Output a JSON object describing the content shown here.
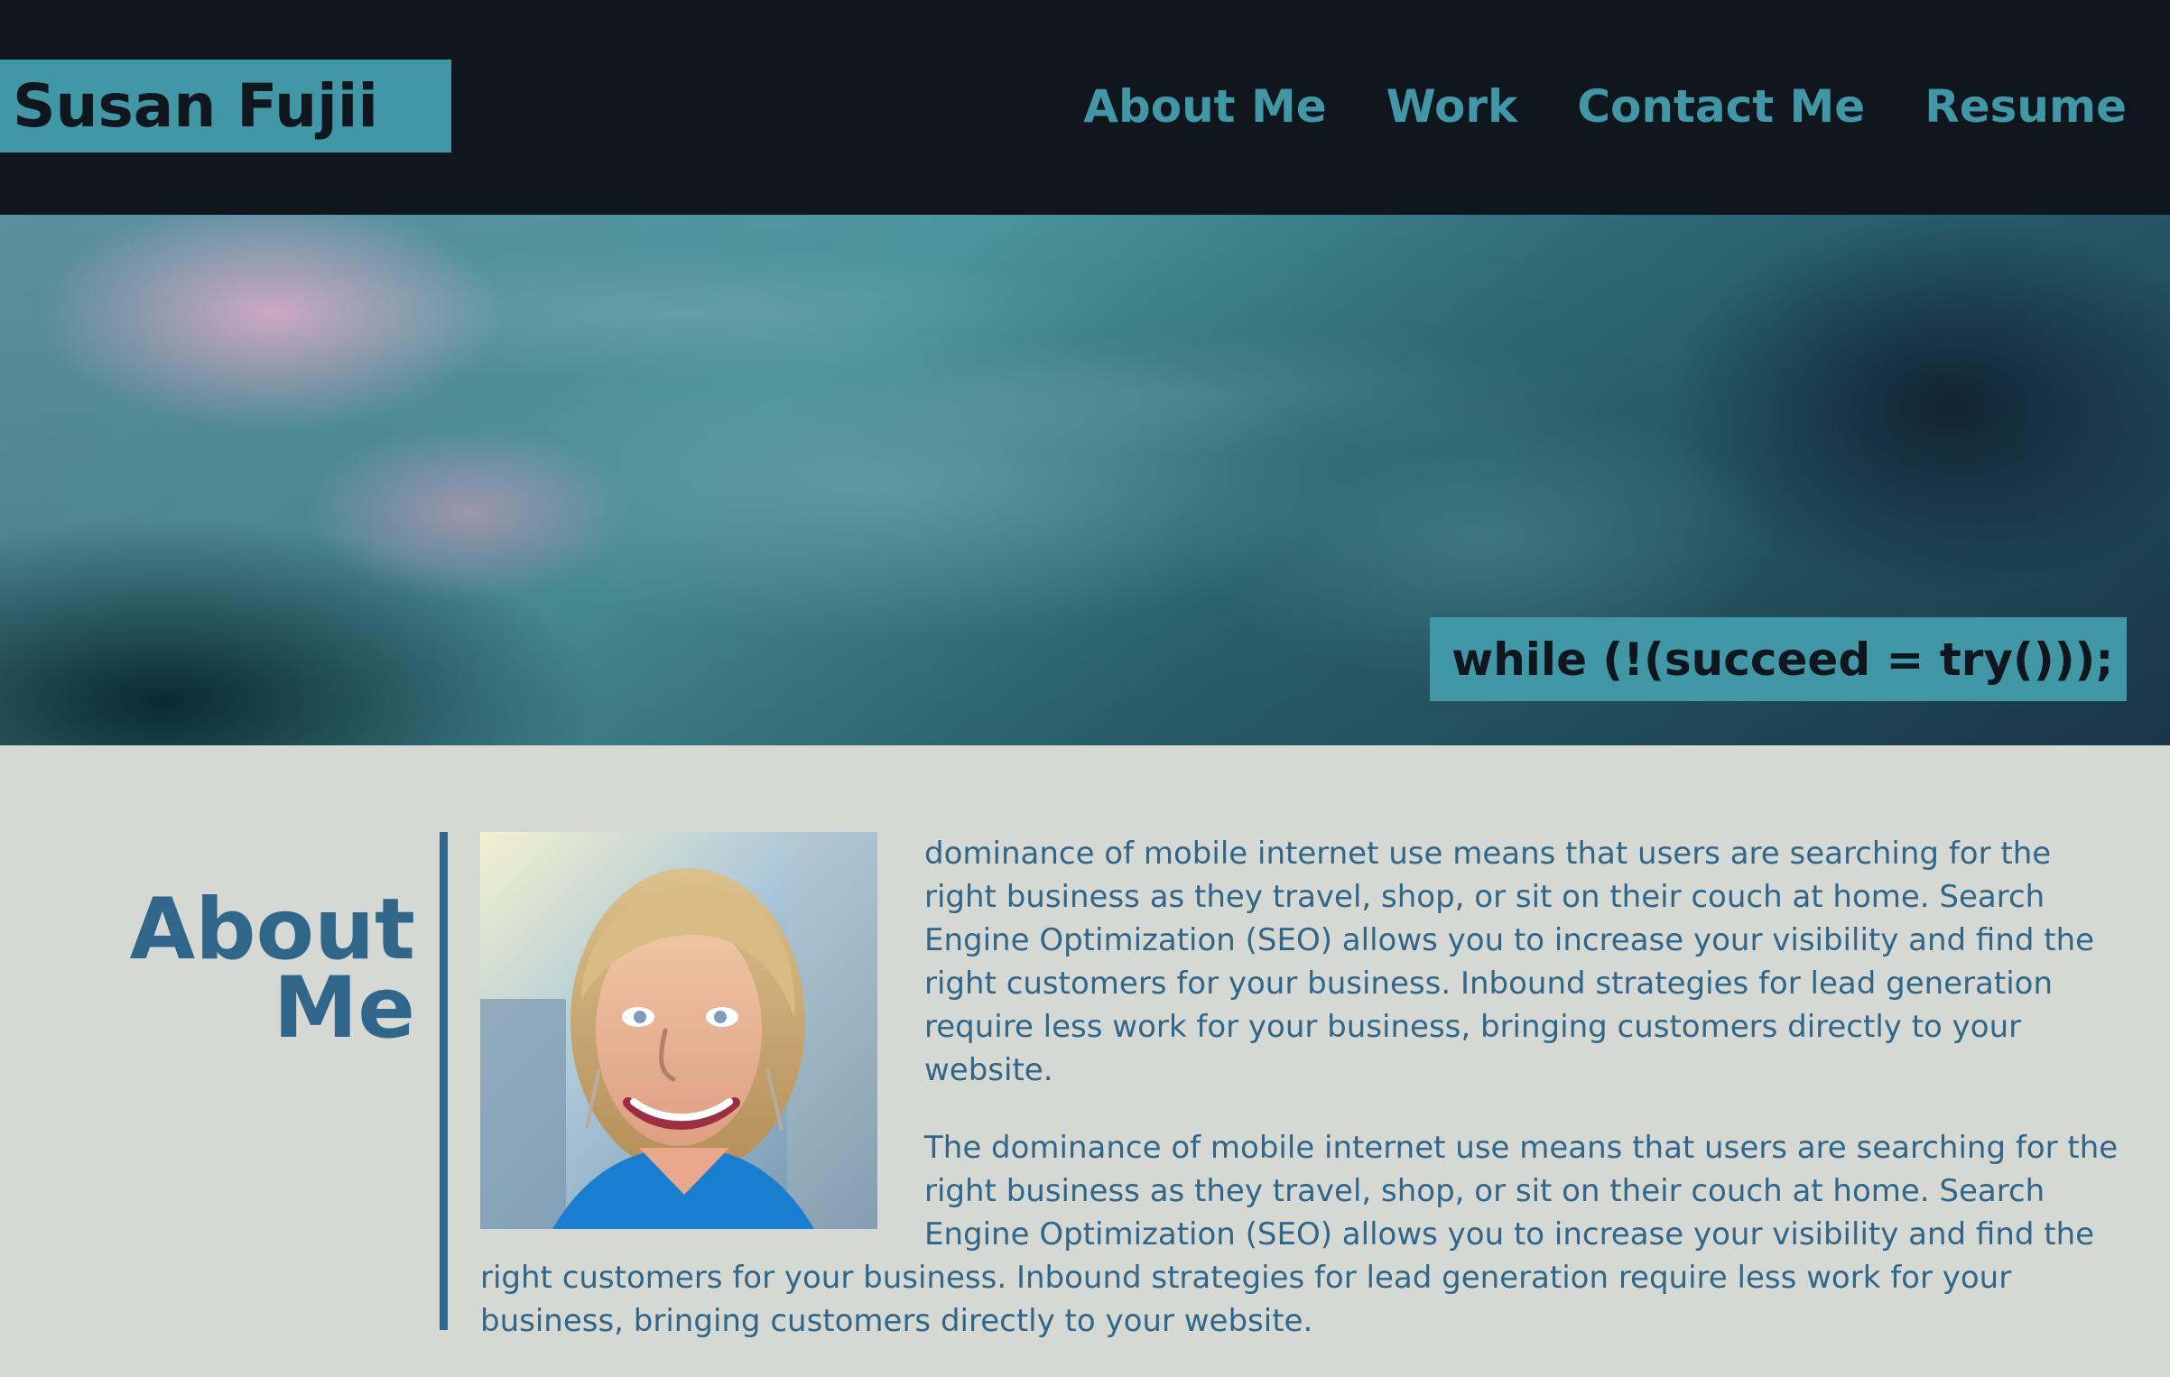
{
  "header": {
    "brand": "Susan Fujii",
    "nav": [
      {
        "label": "About Me"
      },
      {
        "label": "Work"
      },
      {
        "label": "Contact Me"
      },
      {
        "label": "Resume"
      }
    ]
  },
  "hero": {
    "code_line": "while (!(succeed = try()));"
  },
  "about": {
    "title": "About\nMe",
    "paragraphs": [
      "dominance of mobile internet use means that users are searching for the right business as they travel, shop, or sit on their couch at home. Search Engine Optimization (SEO) allows you to increase your visibility and find the right customers for your business. Inbound strategies for lead generation require less work for your business, bringing customers directly to your website.",
      "The dominance of mobile internet use means that users are searching for the right business as they travel, shop, or sit on their couch at home. Search Engine Optimization (SEO) allows you to increase your visibility and find the right customers for your business. Inbound strategies for lead generation require less work for your business, bringing customers directly to your website."
    ]
  },
  "icons": {
    "portrait": "portrait-photo"
  },
  "colors": {
    "header_bg": "#0f161e",
    "accent": "#4197a5",
    "content_bg": "#d6d9d3",
    "text_blue": "#2f6689"
  }
}
